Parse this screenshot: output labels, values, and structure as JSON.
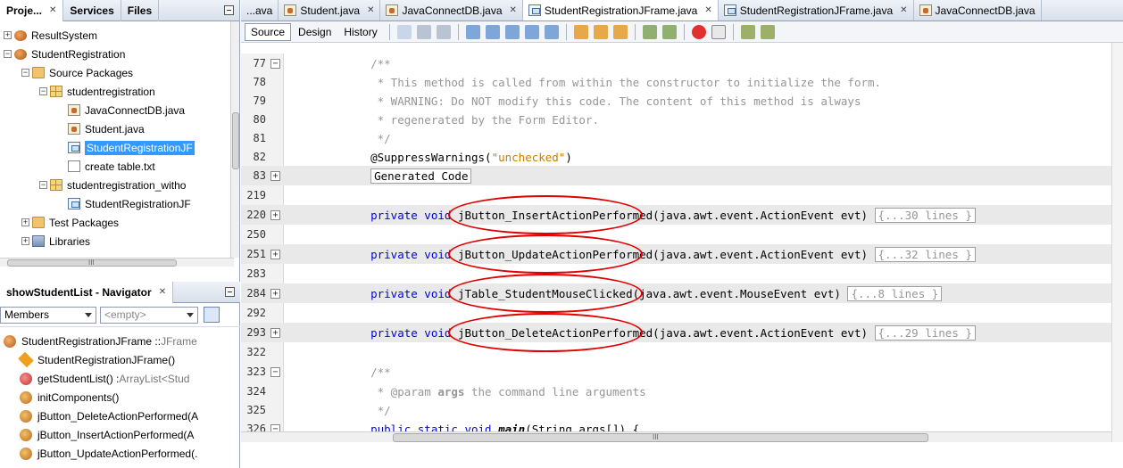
{
  "projects_panel": {
    "tabs": [
      "Proje...",
      "Services",
      "Files"
    ],
    "tree": [
      {
        "label": "ResultSystem",
        "icon": "project-icon",
        "indent": 0,
        "expand": "+"
      },
      {
        "label": "StudentRegistration",
        "icon": "project-icon",
        "indent": 0,
        "expand": "-"
      },
      {
        "label": "Source Packages",
        "icon": "source-folder-icon",
        "indent": 1,
        "expand": "-"
      },
      {
        "label": "studentregistration",
        "icon": "package-icon",
        "indent": 2,
        "expand": "-"
      },
      {
        "label": "JavaConnectDB.java",
        "icon": "java-file-icon",
        "indent": 3,
        "expand": ""
      },
      {
        "label": "Student.java",
        "icon": "java-file-icon",
        "indent": 3,
        "expand": ""
      },
      {
        "label": "StudentRegistrationJF",
        "icon": "form-file-icon",
        "indent": 3,
        "expand": "",
        "selected": true
      },
      {
        "label": "create table.txt",
        "icon": "text-file-icon",
        "indent": 3,
        "expand": ""
      },
      {
        "label": "studentregistration_witho",
        "icon": "package-icon",
        "indent": 2,
        "expand": "-"
      },
      {
        "label": "StudentRegistrationJF",
        "icon": "form-file-icon",
        "indent": 3,
        "expand": ""
      },
      {
        "label": "Test Packages",
        "icon": "source-folder-icon",
        "indent": 1,
        "expand": "+"
      },
      {
        "label": "Libraries",
        "icon": "library-icon",
        "indent": 1,
        "expand": "+"
      }
    ],
    "hscroll_glyph": "III"
  },
  "navigator_panel": {
    "title": "showStudentList - Navigator",
    "members_label": "Members",
    "filter_value": "<empty>",
    "items": [
      {
        "name": "StudentRegistrationJFrame :: ",
        "type": "JFrame",
        "icon": "class-icon",
        "indent": 0
      },
      {
        "name": "StudentRegistrationJFrame()",
        "type": "",
        "icon": "constructor-icon",
        "indent": 1
      },
      {
        "name": "getStudentList() : ",
        "type": "ArrayList<Stud",
        "icon": "method-icon",
        "indent": 1
      },
      {
        "name": "initComponents()",
        "type": "",
        "icon": "private-method-icon",
        "indent": 1
      },
      {
        "name": "jButton_DeleteActionPerformed(A",
        "type": "",
        "icon": "private-method-icon",
        "indent": 1
      },
      {
        "name": "jButton_InsertActionPerformed(A",
        "type": "",
        "icon": "private-method-icon",
        "indent": 1
      },
      {
        "name": "jButton_UpdateActionPerformed(.",
        "type": "",
        "icon": "private-method-icon",
        "indent": 1
      }
    ]
  },
  "editor": {
    "tabs": [
      {
        "label": "...ava",
        "icon": "",
        "close": false
      },
      {
        "label": "Student.java",
        "icon": "java-file-icon",
        "close": true
      },
      {
        "label": "JavaConnectDB.java",
        "icon": "java-file-icon",
        "close": true
      },
      {
        "label": "StudentRegistrationJFrame.java",
        "icon": "form-file-icon",
        "close": true,
        "active": true
      },
      {
        "label": "StudentRegistrationJFrame.java",
        "icon": "form-file-icon",
        "close": true
      },
      {
        "label": "JavaConnectDB.java",
        "icon": "java-file-icon",
        "close": false
      }
    ],
    "toolbar": {
      "source": "Source",
      "design": "History",
      "design_label": "Design"
    },
    "hscroll_glyph": "III",
    "lines": [
      {
        "num": "77",
        "fold": "-",
        "parts": [
          {
            "t": "    /**",
            "c": "cm"
          }
        ]
      },
      {
        "num": "78",
        "fold": "",
        "parts": [
          {
            "t": "     * This method is called from within the constructor to initialize the form.",
            "c": "cm"
          }
        ]
      },
      {
        "num": "79",
        "fold": "",
        "parts": [
          {
            "t": "     * WARNING: Do NOT modify this code. The content of this method is always",
            "c": "cm"
          }
        ]
      },
      {
        "num": "80",
        "fold": "",
        "parts": [
          {
            "t": "     * regenerated by the Form Editor.",
            "c": "cm"
          }
        ]
      },
      {
        "num": "81",
        "fold": "",
        "parts": [
          {
            "t": "     */",
            "c": "cm"
          }
        ]
      },
      {
        "num": "82",
        "fold": "",
        "parts": [
          {
            "t": "    @SuppressWarnings(",
            "c": "ann"
          },
          {
            "t": "\"unchecked\"",
            "c": "str"
          },
          {
            "t": ")",
            "c": "ann"
          }
        ]
      },
      {
        "num": "83",
        "fold": "+",
        "hl": true,
        "parts": [
          {
            "t": "    ",
            "c": ""
          },
          {
            "t": "Generated Code",
            "c": "boxed"
          }
        ]
      },
      {
        "num": "219",
        "fold": "",
        "parts": []
      },
      {
        "num": "220",
        "fold": "+",
        "hl": true,
        "parts": [
          {
            "t": "    private void ",
            "c": "kw"
          },
          {
            "t": "jButton_InsertActionPerformed(java.awt.event.ActionEvent evt) ",
            "c": ""
          },
          {
            "t": "{...30 lines }",
            "c": "boxed cm"
          }
        ]
      },
      {
        "num": "250",
        "fold": "",
        "parts": []
      },
      {
        "num": "251",
        "fold": "+",
        "hl": true,
        "parts": [
          {
            "t": "    private void ",
            "c": "kw"
          },
          {
            "t": "jButton_UpdateActionPerformed(java.awt.event.ActionEvent evt) ",
            "c": ""
          },
          {
            "t": "{...32 lines }",
            "c": "boxed cm"
          }
        ]
      },
      {
        "num": "283",
        "fold": "",
        "parts": []
      },
      {
        "num": "284",
        "fold": "+",
        "hl": true,
        "parts": [
          {
            "t": "    private void ",
            "c": "kw"
          },
          {
            "t": "jTable_StudentMouseClicked(java.awt.event.MouseEvent evt) ",
            "c": ""
          },
          {
            "t": "{...8 lines }",
            "c": "boxed cm"
          }
        ]
      },
      {
        "num": "292",
        "fold": "",
        "parts": []
      },
      {
        "num": "293",
        "fold": "+",
        "hl": true,
        "parts": [
          {
            "t": "    private void ",
            "c": "kw"
          },
          {
            "t": "jButton_DeleteActionPerformed(java.awt.event.ActionEvent evt) ",
            "c": ""
          },
          {
            "t": "{...29 lines }",
            "c": "boxed cm"
          }
        ]
      },
      {
        "num": "322",
        "fold": "",
        "parts": []
      },
      {
        "num": "323",
        "fold": "-",
        "parts": [
          {
            "t": "    /**",
            "c": "cm"
          }
        ]
      },
      {
        "num": "324",
        "fold": "",
        "parts": [
          {
            "t": "     * @param ",
            "c": "cm"
          },
          {
            "t": "args",
            "c": "cm b"
          },
          {
            "t": " the command line arguments",
            "c": "cm"
          }
        ]
      },
      {
        "num": "325",
        "fold": "",
        "parts": [
          {
            "t": "     */",
            "c": "cm"
          }
        ]
      },
      {
        "num": "326",
        "fold": "-",
        "parts": [
          {
            "t": "    public static void ",
            "c": "kw"
          },
          {
            "t": "main",
            "c": "bi"
          },
          {
            "t": "(String args[]) {",
            "c": ""
          }
        ]
      }
    ]
  },
  "colors": {
    "selection": "#3399ff",
    "annotation_oval": "#e00000",
    "keyword": "#0000e6",
    "string": "#ce7b00",
    "comment": "#969696"
  }
}
